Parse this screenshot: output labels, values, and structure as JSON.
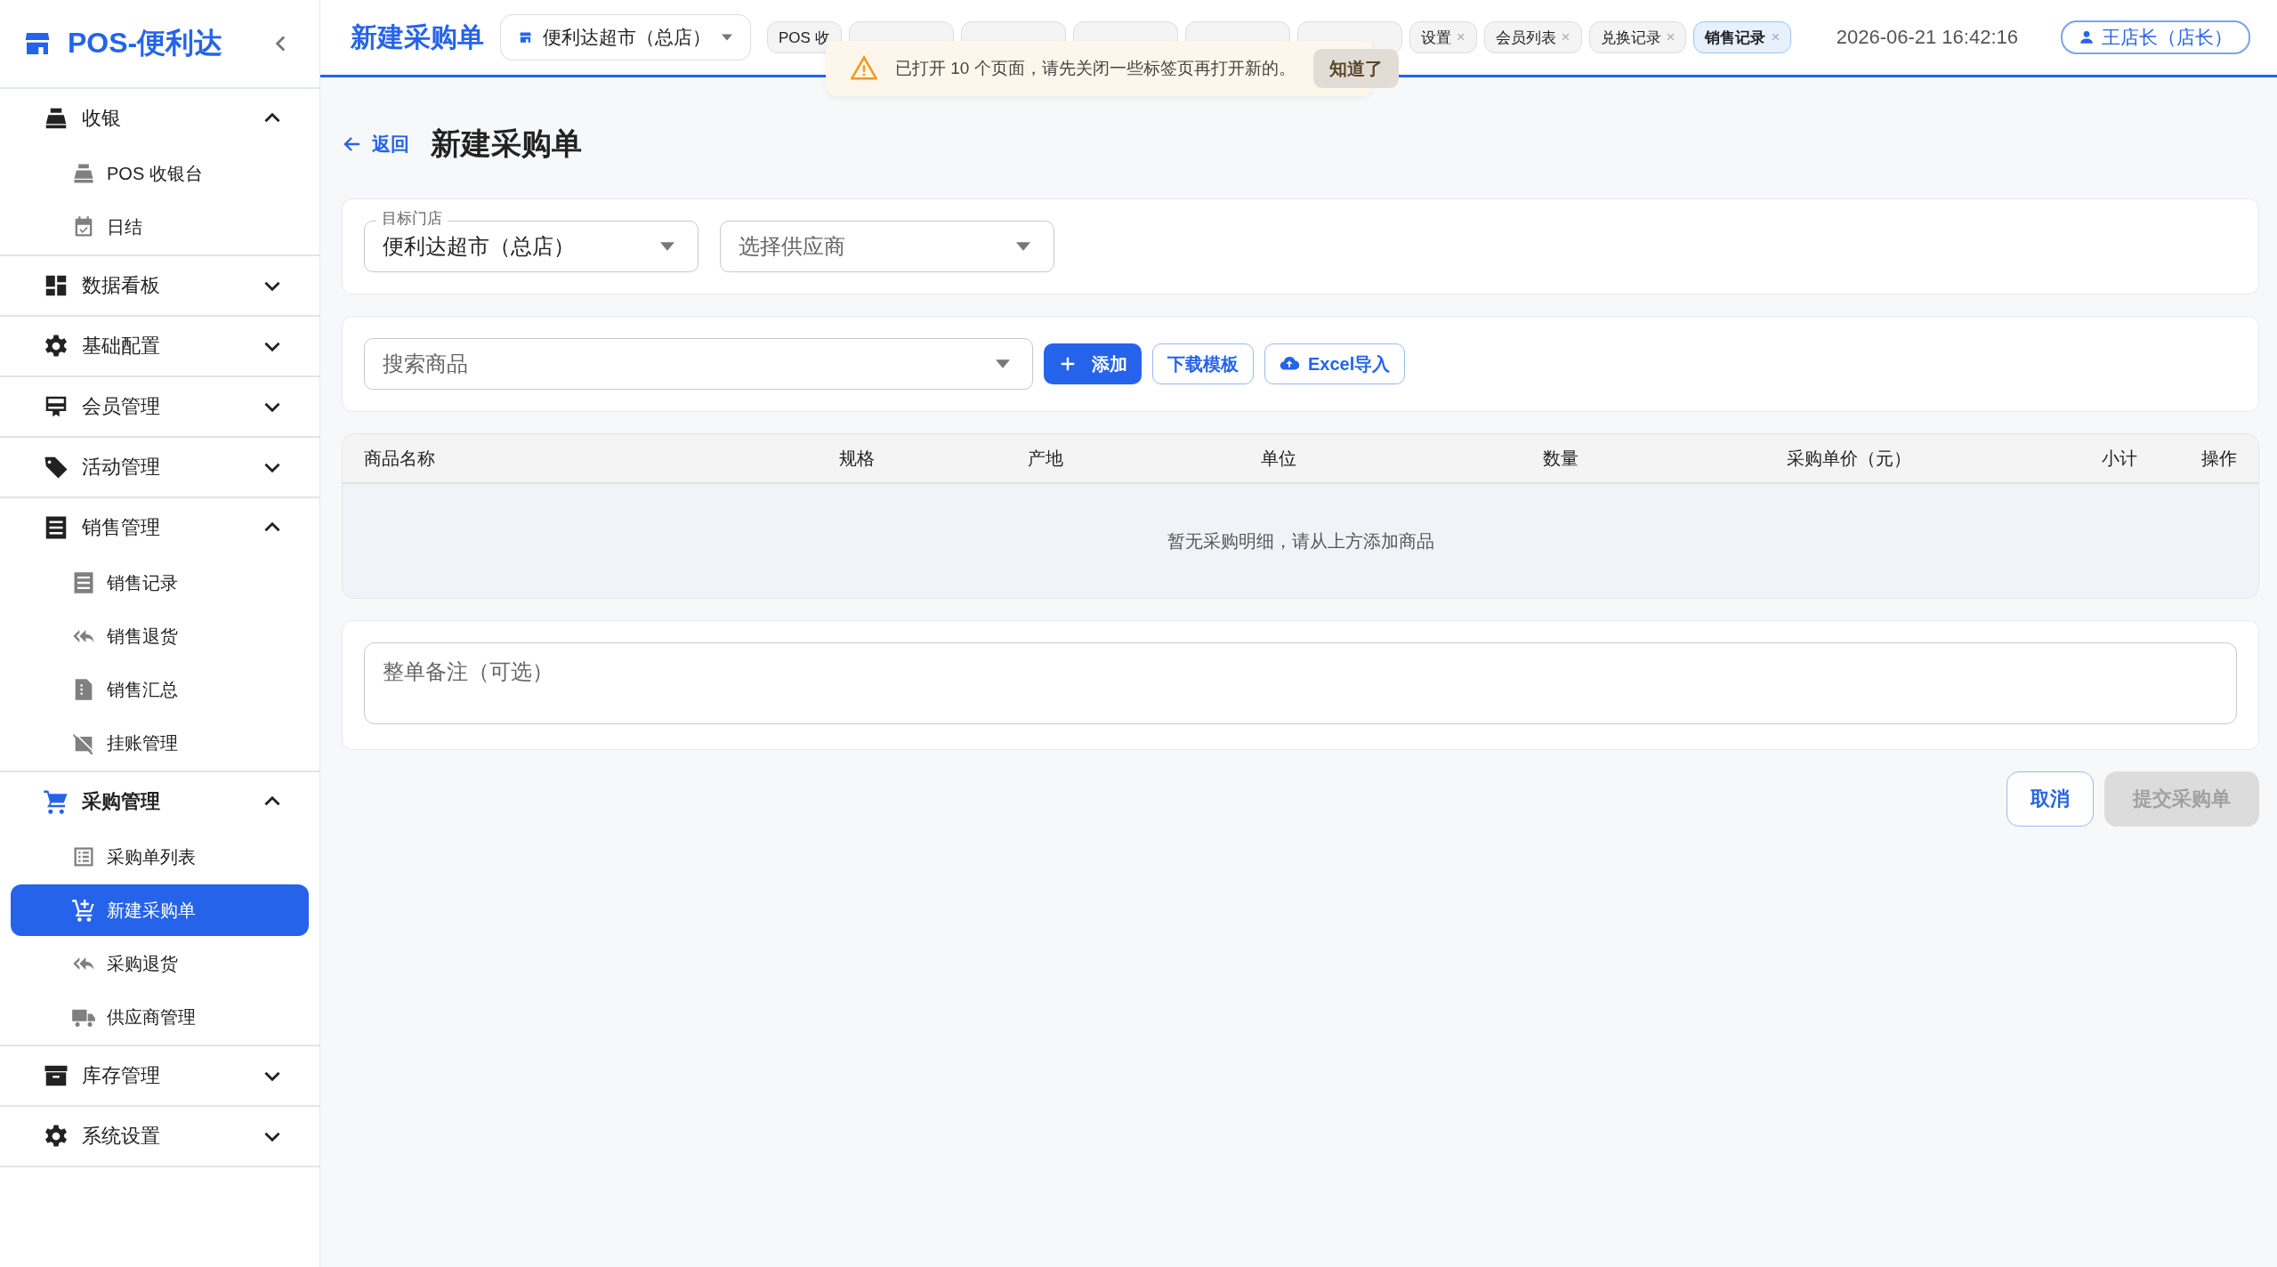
{
  "brand": {
    "name": "POS-便利达"
  },
  "sidebar": {
    "groups": [
      {
        "label": "收银",
        "expanded": true,
        "children": [
          {
            "label": "POS 收银台",
            "selected": false
          },
          {
            "label": "日结",
            "selected": false
          }
        ]
      },
      {
        "label": "数据看板",
        "expanded": false
      },
      {
        "label": "基础配置",
        "expanded": false
      },
      {
        "label": "会员管理",
        "expanded": false
      },
      {
        "label": "活动管理",
        "expanded": false
      },
      {
        "label": "销售管理",
        "expanded": true,
        "children": [
          {
            "label": "销售记录",
            "selected": false
          },
          {
            "label": "销售退货",
            "selected": false
          },
          {
            "label": "销售汇总",
            "selected": false
          },
          {
            "label": "挂账管理",
            "selected": false
          }
        ]
      },
      {
        "label": "采购管理",
        "expanded": true,
        "children": [
          {
            "label": "采购单列表",
            "selected": false
          },
          {
            "label": "新建采购单",
            "selected": true
          },
          {
            "label": "采购退货",
            "selected": false
          },
          {
            "label": "供应商管理",
            "selected": false
          }
        ]
      },
      {
        "label": "库存管理",
        "expanded": false
      },
      {
        "label": "系统设置",
        "expanded": false
      }
    ]
  },
  "topbar": {
    "title": "新建采购单",
    "store_select": "便利达超市（总店）",
    "tabs": [
      {
        "label": "POS 收",
        "selected": false
      },
      {
        "selected": false
      },
      {
        "selected": false
      },
      {
        "selected": false
      },
      {
        "selected": false
      },
      {
        "selected": false
      },
      {
        "label": "设置",
        "close": "×",
        "selected": false
      },
      {
        "label": "会员列表",
        "close": "×",
        "selected": false
      },
      {
        "label": "兑换记录",
        "close": "×",
        "selected": false
      },
      {
        "label": "销售记录",
        "close": "×",
        "selected": true
      }
    ],
    "datetime": "2026-06-21 16:42:16",
    "user": "王店长（店长）"
  },
  "alert": {
    "message": "已打开 10 个页面，请先关闭一些标签页再打开新的。",
    "button": "知道了"
  },
  "page": {
    "back": "返回",
    "title": "新建采购单",
    "target_store": {
      "label": "目标门店",
      "value": "便利达超市（总店）"
    },
    "supplier": {
      "placeholder": "选择供应商"
    },
    "product_search": {
      "placeholder": "搜索商品"
    },
    "actions": [
      "添加",
      "下载模板",
      "Excel导入"
    ],
    "table": {
      "columns": [
        "商品名称",
        "规格",
        "产地",
        "单位",
        "数量",
        "采购单价（元）",
        "小计",
        "操作"
      ],
      "empty": "暂无采购明细，请从上方添加商品"
    },
    "remark": {
      "placeholder": "整单备注（可选）"
    },
    "buttons": [
      {
        "label": "取消",
        "disabled": false
      },
      {
        "label": "提交采购单",
        "disabled": true
      }
    ]
  }
}
